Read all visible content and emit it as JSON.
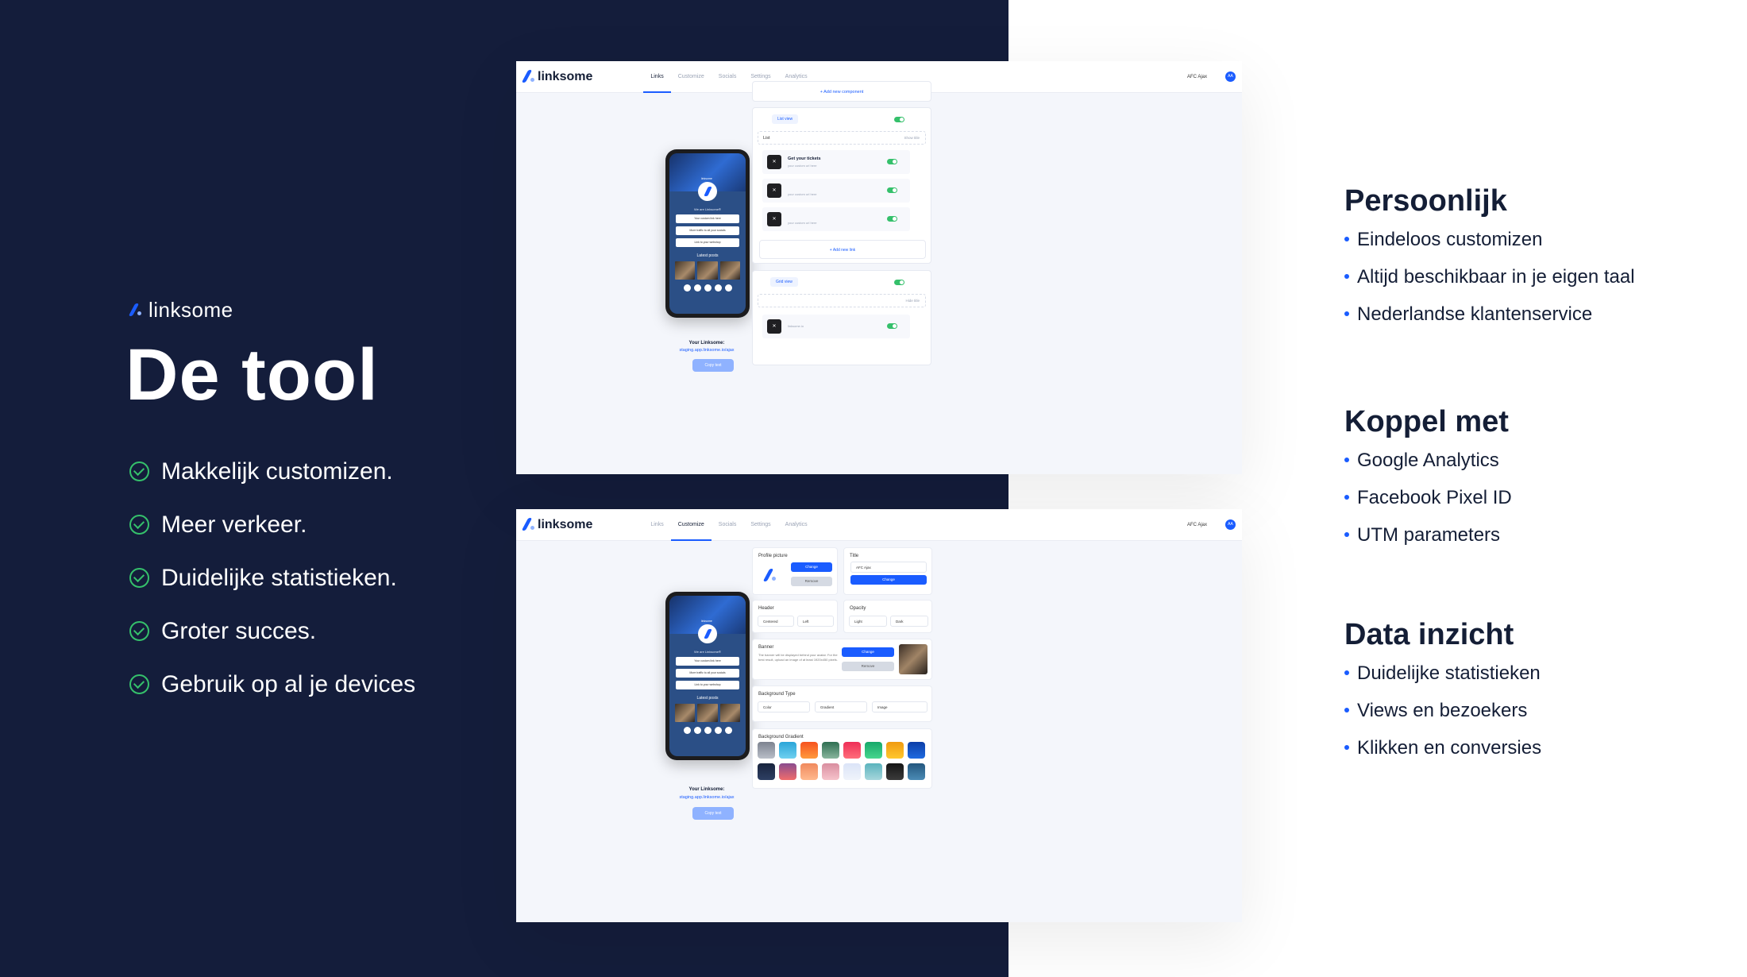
{
  "colors": {
    "left_panel": "#141d3b",
    "accent": "#1a5cff",
    "success": "#35c06b",
    "text_dark": "#141e36"
  },
  "brand": {
    "name": "linksome"
  },
  "hero": {
    "title": "De tool",
    "features": [
      "Makkelijk customizen.",
      "Meer verkeer.",
      "Duidelijke statistieken.",
      "Groter succes.",
      "Gebruik op al je devices"
    ]
  },
  "app": {
    "logo": "linksome",
    "nav": [
      "Links",
      "Customize",
      "Socials",
      "Settings",
      "Analytics"
    ],
    "user": "AFC Ajax",
    "avatar": "AA",
    "phone": {
      "tag": "linksome",
      "bio": "We are Linksome®",
      "buttons": [
        "Your custom link here",
        "More traffic to all your socials",
        "Link to your webshop"
      ],
      "latest_posts": "Latest posts"
    },
    "your_linksome": "Your Linksome:",
    "url": "staging.app.linksome.io/ajax",
    "copy_text": "Copy text"
  },
  "shot1": {
    "add_component": "+ Add new component",
    "list_view": "List view",
    "list_input": "List",
    "show_title": "Show title",
    "items": [
      {
        "title": "Get your tickets",
        "subtitle": "your custom url here"
      },
      {
        "title": "",
        "subtitle": "your custom url here"
      },
      {
        "title": "",
        "subtitle": "your custom url here"
      }
    ],
    "add_link": "+ Add new link",
    "grid_view": "Grid view",
    "hide_title": "Hide title",
    "grid_item": "linksome.io"
  },
  "shot2": {
    "profile_picture": "Profile picture",
    "change": "Change",
    "remove": "Remove",
    "title_label": "Title",
    "title_value": "AFC Ajax",
    "header_label": "Header",
    "header_options": [
      "Centered",
      "Left"
    ],
    "opacity_label": "Opacity",
    "opacity_options": [
      "Light",
      "Dark"
    ],
    "banner_label": "Banner",
    "banner_desc": "The banner will be displayed behind your avatar. For the best result, upload an image of at least 1920x450 pixels.",
    "bg_type_label": "Background Type",
    "bg_type_options": [
      "Color",
      "Gradient",
      "Image"
    ],
    "bg_gradient_label": "Background Gradient",
    "gradients": [
      [
        "#7d8390",
        "#b9bec8"
      ],
      [
        "#2aa5d8",
        "#6fd0f0"
      ],
      [
        "#f6531f",
        "#ff9a3c"
      ],
      [
        "#2f6f52",
        "#88b59d"
      ],
      [
        "#ee2f57",
        "#ff6d7a"
      ],
      [
        "#17a86a",
        "#47d68e"
      ],
      [
        "#f09a10",
        "#ffc82e"
      ],
      [
        "#0c3ea8",
        "#1e6ae0"
      ],
      [
        "#18243e",
        "#2d3f63"
      ],
      [
        "#8a4c8f",
        "#f06c6c"
      ],
      [
        "#f08a5e",
        "#ffb98e"
      ],
      [
        "#d98ea0",
        "#f6c3cb"
      ],
      [
        "#dbe4f7",
        "#eff3fb"
      ],
      [
        "#5bb3bd",
        "#a6d6dc"
      ],
      [
        "#151515",
        "#3b3b3b"
      ],
      [
        "#23577f",
        "#4b8bb5"
      ]
    ]
  },
  "right": {
    "sections": [
      {
        "title": "Persoonlijk",
        "items": [
          "Eindeloos customizen",
          "Altijd beschikbaar in je eigen taal",
          "Nederlandse klantenservice"
        ]
      },
      {
        "title": "Koppel met",
        "items": [
          "Google Analytics",
          "Facebook Pixel ID",
          "UTM parameters"
        ]
      },
      {
        "title": "Data inzicht",
        "items": [
          "Duidelijke statistieken",
          "Views en bezoekers",
          "Klikken en conversies"
        ]
      }
    ]
  }
}
